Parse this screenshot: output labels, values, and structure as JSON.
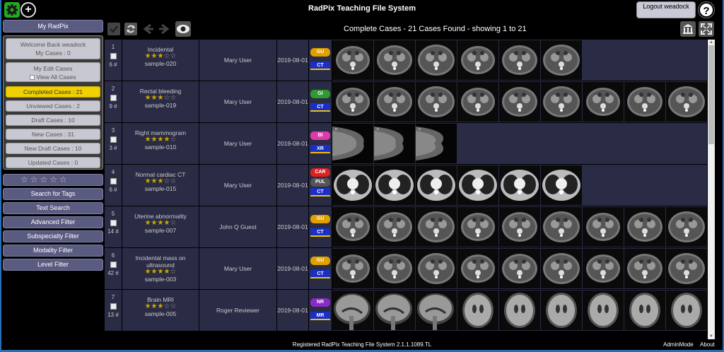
{
  "app": {
    "title": "RadPix Teaching File System"
  },
  "topbar": {
    "logout_label": "Logout weadock",
    "help_label": "?"
  },
  "sidebar": {
    "my_radpix": "My RadPix",
    "welcome": "Welcome Back weadock",
    "my_cases": "My Cases : 0",
    "my_edit_cases": "My Edit Cases",
    "view_all_cases": "View All Cases",
    "items": [
      {
        "label": "Completed Cases : 21",
        "active": true
      },
      {
        "label": "Unviewed Cases : 2"
      },
      {
        "label": "Draft Cases : 10"
      },
      {
        "label": "New Cases : 31"
      },
      {
        "label": "New Draft Cases : 10"
      },
      {
        "label": "Updated Cases : 0"
      }
    ],
    "rating_filter": "☆☆☆☆☆",
    "filters": [
      "Search for Tags",
      "Text Search",
      "Advanced Filter",
      "Subspecialty Filter",
      "Modality Filter",
      "Level Filter"
    ]
  },
  "list": {
    "title": "Complete Cases - 21 Cases Found - showing 1 to 21"
  },
  "cases": [
    {
      "num": "1",
      "count": "6 #",
      "title": "Incidental",
      "stars": 3,
      "id": "sample-020",
      "user": "Mary User",
      "date": "2019-08-01",
      "tags": [
        {
          "label": "GU",
          "color": "#e0a000"
        }
      ],
      "modality": "CT",
      "images": 6,
      "kind": "abd"
    },
    {
      "num": "2",
      "count": "9 #",
      "title": "Rectal bleeding",
      "stars": 3,
      "id": "sample-019",
      "user": "Mary User",
      "date": "2019-08-01",
      "tags": [
        {
          "label": "GI",
          "color": "#2f9a2f"
        }
      ],
      "modality": "CT",
      "images": 9,
      "kind": "abd"
    },
    {
      "num": "3",
      "count": "3 #",
      "title": "Right mammogram",
      "stars": 4,
      "id": "sample-010",
      "user": "Mary User",
      "date": "2019-08-01",
      "tags": [
        {
          "label": "BI",
          "color": "#e03aa8"
        }
      ],
      "modality": "XR",
      "images": 3,
      "kind": "mammo"
    },
    {
      "num": "4",
      "count": "6 #",
      "title": "Normal cardiac CT",
      "stars": 3,
      "id": "sample-015",
      "user": "Mary User",
      "date": "2019-08-01",
      "tags": [
        {
          "label": "CAR",
          "color": "#e02020"
        },
        {
          "label": "PUL",
          "color": "#555555"
        }
      ],
      "modality": "CT",
      "images": 6,
      "kind": "chest"
    },
    {
      "num": "5",
      "count": "14 #",
      "title": "Uterine abnormality",
      "stars": 4,
      "id": "sample-007",
      "user": "John Q Guest",
      "date": "2019-08-01",
      "tags": [
        {
          "label": "GU",
          "color": "#e0a000"
        }
      ],
      "modality": "CT",
      "images": 9,
      "kind": "abd"
    },
    {
      "num": "6",
      "count": "42 #",
      "title": "Incidental mass on ultrasound",
      "stars": 4,
      "id": "sample-003",
      "user": "Mary User",
      "date": "2019-08-01",
      "tags": [
        {
          "label": "GU",
          "color": "#e0a000"
        }
      ],
      "modality": "CT",
      "images": 9,
      "kind": "abd"
    },
    {
      "num": "7",
      "count": "13 #",
      "title": "Brain MRI",
      "stars": 3,
      "id": "sample-005",
      "user": "Roger Reviewer",
      "date": "2019-08-01",
      "tags": [
        {
          "label": "NR",
          "color": "#8a2ac8"
        }
      ],
      "modality": "MR",
      "images": 9,
      "kind": "brain"
    }
  ],
  "footer": {
    "registered": "Registered RadPix Teaching File System 2.1.1.1089.TL",
    "admin": "AdminMode",
    "about": "About"
  }
}
